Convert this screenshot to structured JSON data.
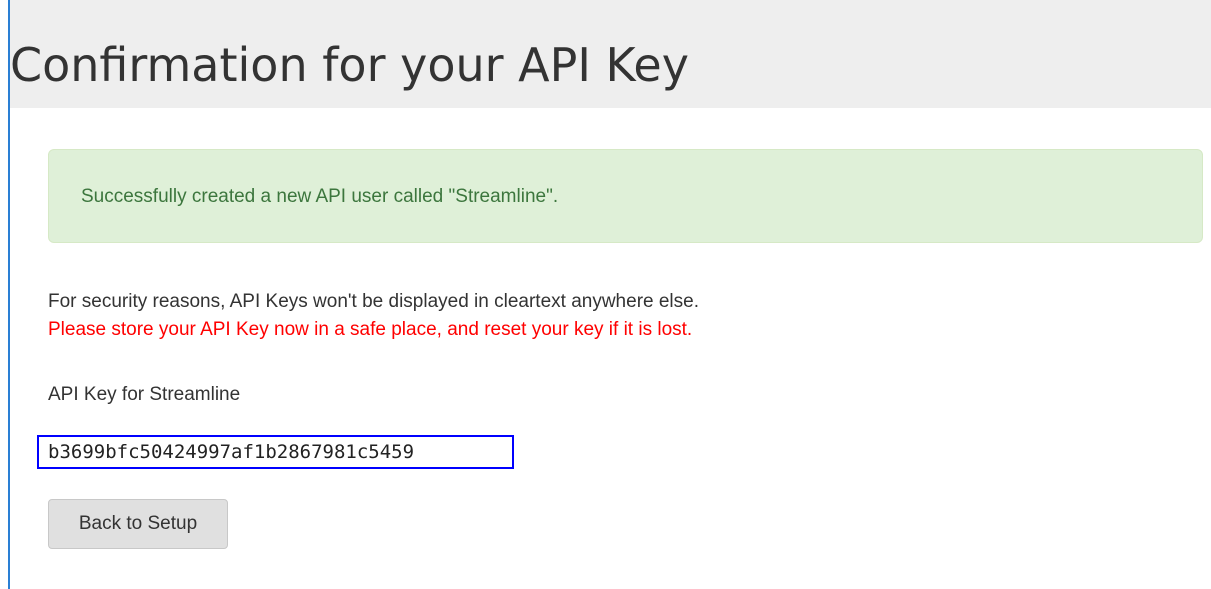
{
  "header": {
    "title": "Confirmation for your API Key"
  },
  "alert": {
    "message": "Successfully created a new API user called \"Streamline\"."
  },
  "notice": {
    "info": "For security reasons, API Keys won't be displayed in cleartext anywhere else.",
    "warning": "Please store your API Key now in a safe place, and reset your key if it is lost."
  },
  "api_key": {
    "label": "API Key for Streamline",
    "value": "b3699bfc50424997af1b2867981c5459"
  },
  "actions": {
    "back_label": "Back to Setup"
  },
  "colors": {
    "alert_background": "#dff0d8",
    "alert_text": "#3c763d",
    "warning_text": "#ff0000",
    "key_highlight_border": "#0000ff"
  }
}
